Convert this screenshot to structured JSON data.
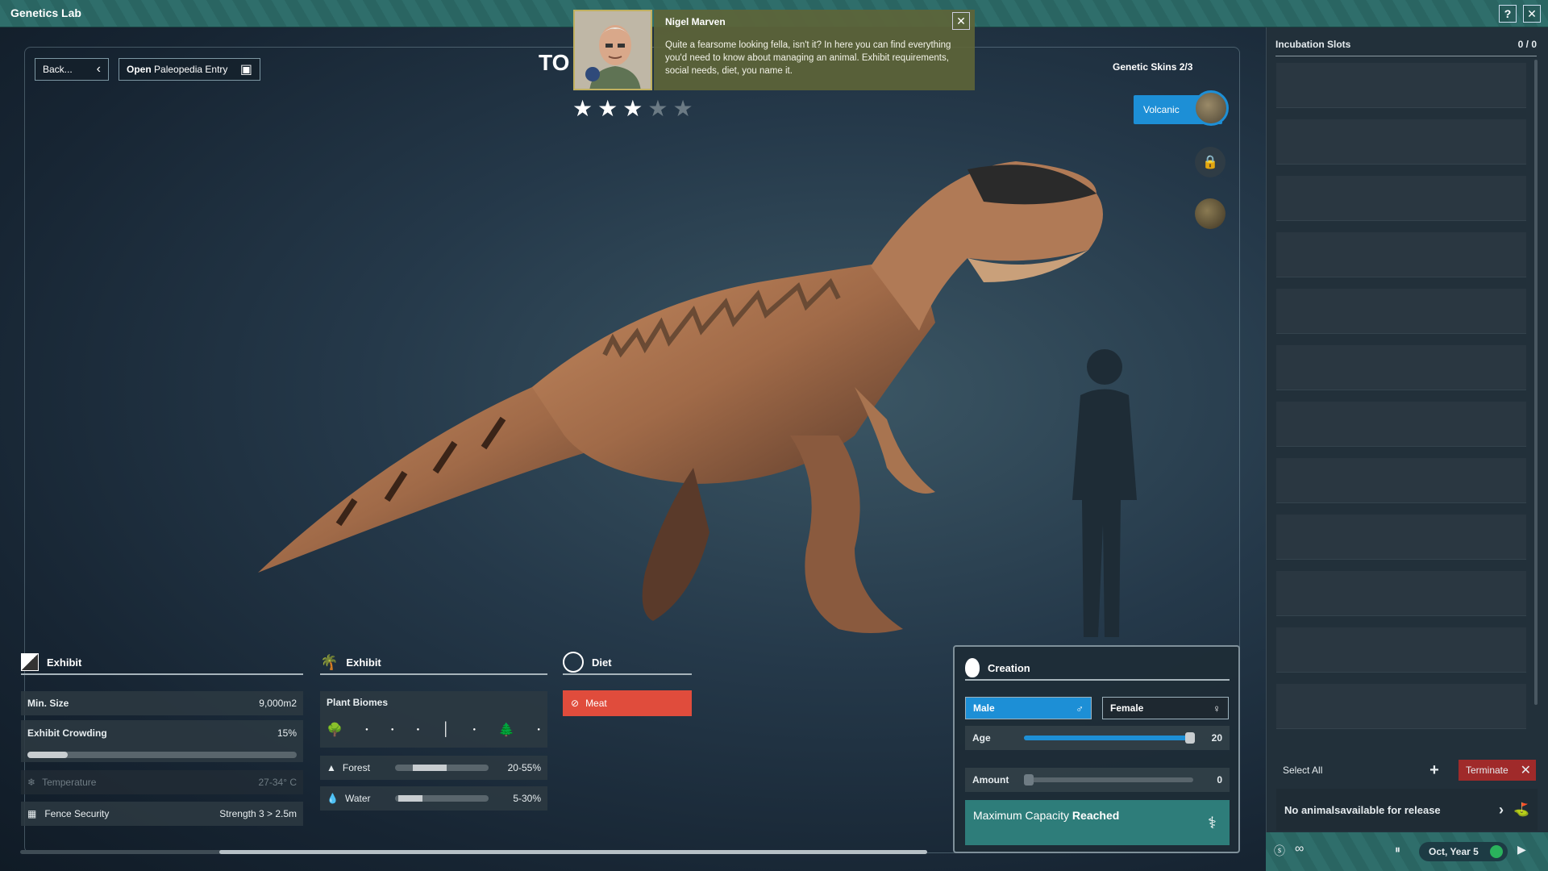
{
  "window": {
    "title": "Genetics Lab",
    "help_label": "?",
    "close_label": "✕"
  },
  "nav": {
    "back_label": "Back...",
    "paleopedia_bold": "Open",
    "paleopedia_label": "Paleopedia Entry"
  },
  "species": {
    "code": "TO",
    "rating": 3,
    "max_rating": 5
  },
  "character": {
    "name": "Nigel Marven",
    "message": "Quite a fearsome looking fella, isn't it? In here you can find everything you'd need to know about managing an animal. Exhibit requirements, social needs, diet, you name it."
  },
  "skins": {
    "title": "Genetic Skins 2/3",
    "selected": "Volcanic"
  },
  "exhibit": {
    "header": "Exhibit",
    "min_size_label": "Min. Size",
    "min_size_value": "9,000m2",
    "crowding_label": "Exhibit Crowding",
    "crowding_value": "15%",
    "crowding_fraction": 0.15,
    "temperature_label": "Temperature",
    "temperature_value": "27-34° C",
    "fence_label": "Fence Security",
    "fence_value": "Strength 3 > 2.5m"
  },
  "exhibit2": {
    "header": "Exhibit",
    "biomes_label": "Plant Biomes",
    "forest_label": "Forest",
    "forest_value": "20-55%",
    "water_label": "Water",
    "water_value": "5-30%"
  },
  "diet": {
    "header": "Diet",
    "meat_label": "Meat"
  },
  "creation": {
    "header": "Creation",
    "male_label": "Male",
    "female_label": "Female",
    "age_label": "Age",
    "age_value": "20",
    "age_fraction": 0.98,
    "amount_label": "Amount",
    "amount_value": "0",
    "status_normal": "Maximum Capacity ",
    "status_bold": "Reached"
  },
  "incubation": {
    "title": "Incubation Slots",
    "count": "0 / 0",
    "select_all": "Select All",
    "terminate": "Terminate",
    "release_bold": "No animals",
    "release_text": " available for release"
  },
  "status": {
    "date": "Oct, Year 5",
    "infinity": "∞"
  },
  "colors": {
    "accent_blue": "#1d8fd6",
    "danger_red": "#e04c3c",
    "teal": "#2e7d7a",
    "speech_bg": "#5d6438"
  }
}
